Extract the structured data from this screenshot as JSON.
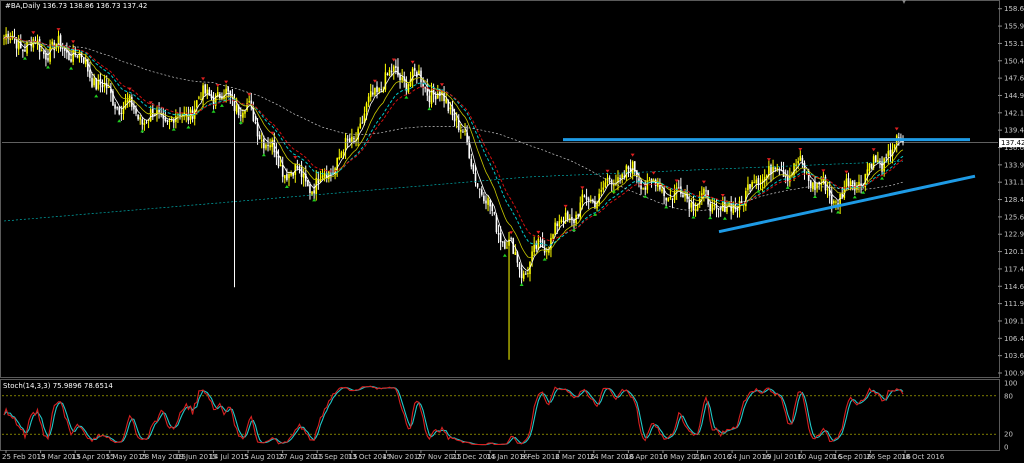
{
  "header": {
    "symbol_line": "#BA,Daily  136.73 138.86 136.73 137.42"
  },
  "stoch_header": "Stoch(14,3,3) 75.9896 78.6514",
  "colors": {
    "background": "#000000",
    "bull_candle": "#ffff00",
    "bear_candle": "#ffffff",
    "ma_fast": "#ffffff",
    "ma_red": "#d01010",
    "ma_cyan": "#00c8c8",
    "ma_yellow": "#c8c800",
    "ma_long": "#c8c8c8",
    "trend_lines": "#1e9be6",
    "stoch_main": "#d82020",
    "stoch_signal": "#20c8c8",
    "stoch_levels": "#c8c800",
    "current_price_badge": "#ffffff"
  },
  "chart_data": [
    {
      "type": "candlestick",
      "title": "#BA,Daily",
      "ylim": [
        100.9,
        159.4
      ],
      "y_ticks": [
        "158.65",
        "155.90",
        "153.15",
        "150.40",
        "147.65",
        "144.90",
        "142.15",
        "139.40",
        "136.65",
        "133.90",
        "131.15",
        "128.40",
        "125.65",
        "122.90",
        "120.15",
        "117.40",
        "114.65",
        "111.90",
        "109.15",
        "106.40",
        "103.65",
        "100.90"
      ],
      "x_ticks": [
        "25 Feb 2015",
        "19 Mar 2015",
        "13 Apr 2015",
        "5 May 2015",
        "28 May 2015",
        "19 Jun 2015",
        "14 Jul 2015",
        "5 Aug 2015",
        "27 Aug 2015",
        "21 Sep 2015",
        "13 Oct 2015",
        "4 Nov 2015",
        "27 Nov 2015",
        "21 Dec 2015",
        "14 Jan 2016",
        "8 Feb 2016",
        "2 Mar 2016",
        "24 Mar 2016",
        "18 Apr 2016",
        "10 May 2016",
        "2 Jun 2016",
        "24 Jun 2016",
        "19 Jul 2016",
        "10 Aug 2016",
        "1 Sep 2016",
        "26 Sep 2016",
        "18 Oct 2016"
      ],
      "last_price": "137.42",
      "close_path": [
        {
          "x": "25 Feb 2015",
          "y": 154.0
        },
        {
          "x": "19 Mar 2015",
          "y": 152.5
        },
        {
          "x": "13 Apr 2015",
          "y": 152.0
        },
        {
          "x": "5 May 2015",
          "y": 145.0
        },
        {
          "x": "28 May 2015",
          "y": 141.5
        },
        {
          "x": "19 Jun 2015",
          "y": 141.0
        },
        {
          "x": "14 Jul 2015",
          "y": 145.5
        },
        {
          "x": "5 Aug 2015",
          "y": 143.0
        },
        {
          "x": "27 Aug 2015",
          "y": 134.0
        },
        {
          "x": "21 Sep 2015",
          "y": 130.5
        },
        {
          "x": "13 Oct 2015",
          "y": 137.0
        },
        {
          "x": "4 Nov 2015",
          "y": 148.0
        },
        {
          "x": "27 Nov 2015",
          "y": 147.5
        },
        {
          "x": "21 Dec 2015",
          "y": 142.5
        },
        {
          "x": "14 Jan 2016",
          "y": 127.0
        },
        {
          "x": "8 Feb 2016",
          "y": 117.0
        },
        {
          "x": "2 Mar 2016",
          "y": 124.0
        },
        {
          "x": "24 Mar 2016",
          "y": 128.5
        },
        {
          "x": "18 Apr 2016",
          "y": 133.0
        },
        {
          "x": "10 May 2016",
          "y": 130.0
        },
        {
          "x": "2 Jun 2016",
          "y": 128.5
        },
        {
          "x": "24 Jun 2016",
          "y": 126.5
        },
        {
          "x": "19 Jul 2016",
          "y": 133.0
        },
        {
          "x": "10 Aug 2016",
          "y": 133.5
        },
        {
          "x": "1 Sep 2016",
          "y": 128.5
        },
        {
          "x": "26 Sep 2016",
          "y": 133.0
        },
        {
          "x": "18 Oct 2016",
          "y": 137.4
        }
      ],
      "stoch_levels": [
        80,
        20
      ],
      "stoch_ylim": [
        0,
        100
      ],
      "stoch_ticks": [
        "100",
        "80",
        "20",
        "0"
      ]
    }
  ]
}
